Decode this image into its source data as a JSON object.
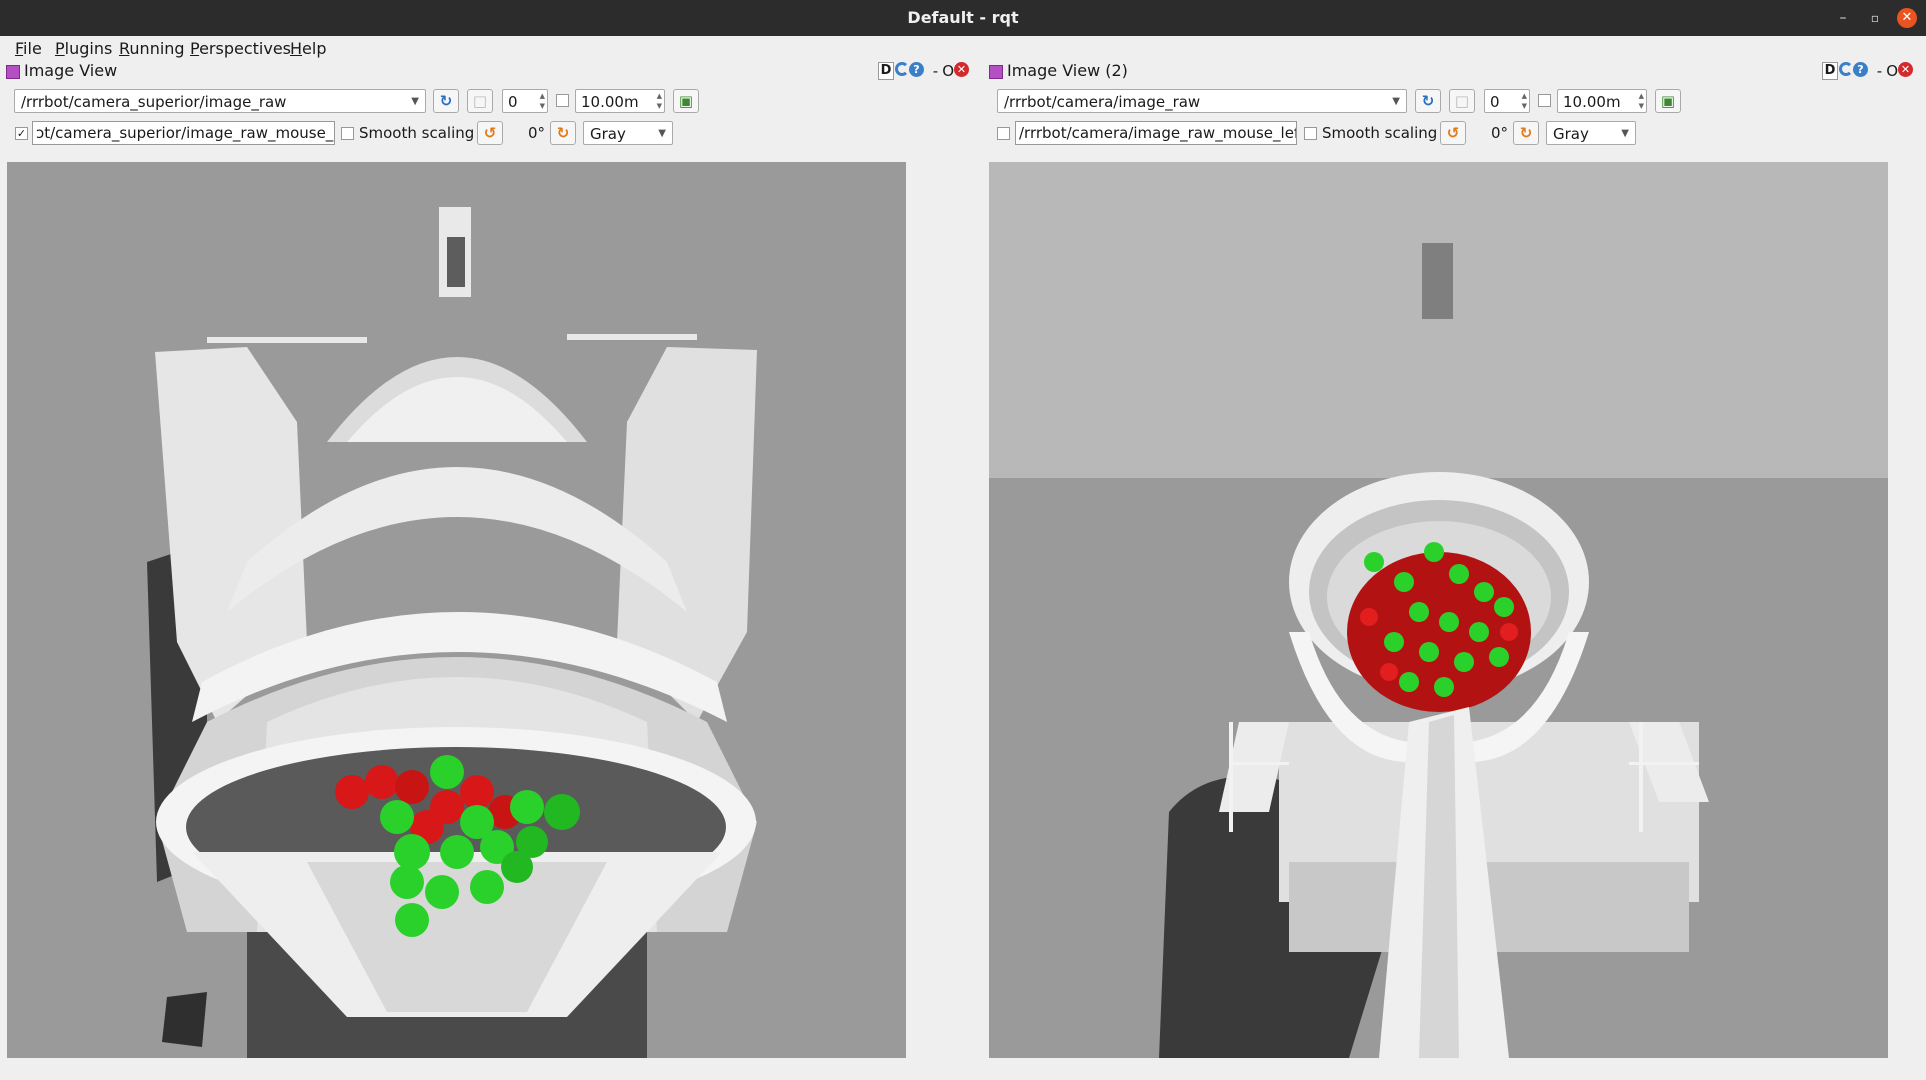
{
  "window": {
    "title": "Default - rqt",
    "min": "–",
    "max": "▫",
    "close": "✕"
  },
  "menu": [
    "File",
    "Plugins",
    "Running",
    "Perspectives",
    "Help"
  ],
  "panels": [
    {
      "title": "Image View",
      "topic": "/rrrbot/camera_superior/image_raw",
      "zoom_value": "0",
      "max_range": "10.00m",
      "mouse_topic": "ɔt/camera_superior/image_raw_mouse_left",
      "mouse_checked": "✓",
      "smooth_label": "Smooth scaling",
      "rotation": "0°",
      "color_scheme": "Gray",
      "dock_d": "D",
      "dock_dash": "-",
      "dock_o": "O"
    },
    {
      "title": "Image View (2)",
      "topic": "/rrrbot/camera/image_raw",
      "zoom_value": "0",
      "max_range": "10.00m",
      "mouse_topic": "/rrrbot/camera/image_raw_mouse_left",
      "mouse_checked": "",
      "smooth_label": "Smooth scaling",
      "rotation": "0°",
      "color_scheme": "Gray",
      "dock_d": "D",
      "dock_dash": "-",
      "dock_o": "O"
    }
  ],
  "icons": {
    "plugin": "plugin-icon",
    "reload": "reload-icon",
    "help": "help-icon",
    "close": "close-icon",
    "refresh": "refresh-icon",
    "zoom": "zoom-icon",
    "save": "save-icon",
    "rotate_left": "rotate-left-icon",
    "rotate_right": "rotate-right-icon"
  },
  "colors": {
    "titlebar": "#2c2c2c",
    "close": "#e95420",
    "red_ball": "#d81818",
    "green_ball": "#2bd12b"
  }
}
